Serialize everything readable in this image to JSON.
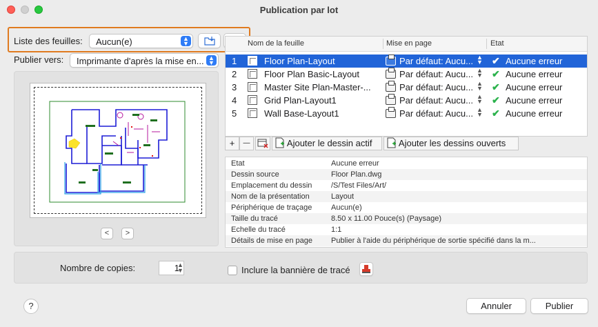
{
  "window": {
    "title": "Publication par lot"
  },
  "sheet_list": {
    "label": "Liste des feuilles:",
    "value": "Aucun(e)"
  },
  "publish_to": {
    "label": "Publier vers:",
    "value": "Imprimante d'après la mise en..."
  },
  "table": {
    "headers": [
      "Nom de la feuille",
      "Mise en page",
      "Etat"
    ],
    "rows": [
      {
        "num": "1",
        "name": "Floor Plan-Layout",
        "setup": "Par défaut: Aucu...",
        "status": "Aucune erreur"
      },
      {
        "num": "2",
        "name": "Floor Plan Basic-Layout",
        "setup": "Par défaut: Aucu...",
        "status": "Aucune erreur"
      },
      {
        "num": "3",
        "name": "Master Site Plan-Master-...",
        "setup": "Par défaut: Aucu...",
        "status": "Aucune erreur"
      },
      {
        "num": "4",
        "name": "Grid Plan-Layout1",
        "setup": "Par défaut: Aucu...",
        "status": "Aucune erreur"
      },
      {
        "num": "5",
        "name": "Wall Base-Layout1",
        "setup": "Par défaut: Aucu...",
        "status": "Aucune erreur"
      }
    ]
  },
  "toolbar": {
    "plus": "+",
    "minus": "—",
    "add_current": "Ajouter le dessin actif",
    "add_open": "Ajouter les dessins ouverts"
  },
  "details": [
    {
      "key": "Etat",
      "value": "Aucune erreur"
    },
    {
      "key": "Dessin source",
      "value": "Floor Plan.dwg"
    },
    {
      "key": "Emplacement du dessin",
      "value": "/S/Test Files/Art/"
    },
    {
      "key": "Nom de la présentation",
      "value": "Layout"
    },
    {
      "key": "Périphérique de traçage",
      "value": "Aucun(e)"
    },
    {
      "key": "Taille du tracé",
      "value": "8.50 x 11.00 Pouce(s) (Paysage)"
    },
    {
      "key": "Echelle du tracé",
      "value": "1:1"
    },
    {
      "key": "Détails de mise en page",
      "value": "Publier à l'aide du périphérique de sortie spécifié dans la m..."
    }
  ],
  "copies": {
    "label": "Nombre de copies:",
    "value": "1"
  },
  "banner": {
    "label": "Inclure la bannière de tracé"
  },
  "buttons": {
    "help": "?",
    "cancel": "Annuler",
    "publish": "Publier",
    "prev": "<",
    "next": ">"
  },
  "colors": {
    "accent": "#2164d8",
    "highlight": "#e07a1f",
    "success": "#2bb24c"
  }
}
